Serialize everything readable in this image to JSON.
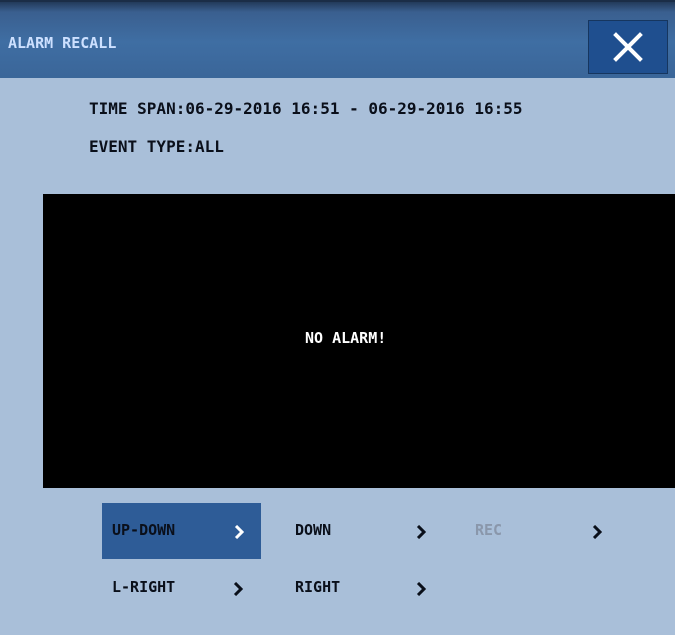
{
  "window": {
    "title": "ALARM RECALL",
    "close_icon": "close-icon"
  },
  "info": {
    "time_span": "TIME SPAN:06-29-2016 16:51 - 06-29-2016 16:55",
    "event_type": "EVENT TYPE:ALL"
  },
  "display": {
    "message": "NO ALARM!"
  },
  "controls": {
    "up_down": "UP-DOWN",
    "down": "DOWN",
    "rec": "REC",
    "l_right": "L-RIGHT",
    "right": "RIGHT",
    "chevron_icon": "chevron-right-icon"
  },
  "colors": {
    "background": "#a9bfd9",
    "titlebar": "#3f6ea3",
    "active_button": "#2e5c97",
    "disabled_text": "#8a97ab"
  }
}
